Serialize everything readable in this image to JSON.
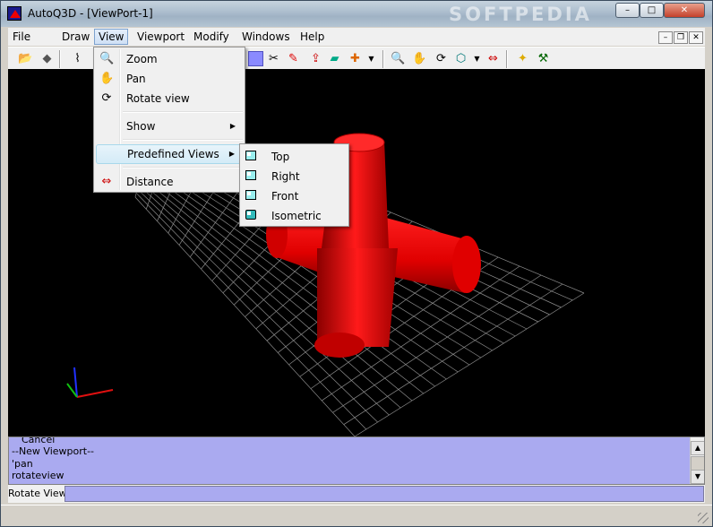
{
  "window": {
    "title": "AutoQ3D - [ViewPort-1]",
    "watermark": "SOFTPEDIA"
  },
  "caption_buttons": {
    "minimize": "–",
    "maximize": "□",
    "close": "✕"
  },
  "menubar": {
    "items": [
      "File",
      "Draw",
      "View",
      "Viewport",
      "Modify",
      "Windows",
      "Help"
    ],
    "active": "View"
  },
  "mdi_buttons": {
    "minimize": "–",
    "restore": "❐",
    "close": "✕"
  },
  "view_menu": {
    "zoom": "Zoom",
    "pan": "Pan",
    "rotate_view": "Rotate view",
    "show": "Show",
    "predefined_views": "Predefined Views",
    "distance": "Distance"
  },
  "predefined_views_submenu": {
    "top": "Top",
    "right": "Right",
    "front": "Front",
    "isometric": "Isometric"
  },
  "command_history": [
    "Cancel",
    "--New Viewport--",
    "'pan",
    "rotateview"
  ],
  "prompt": {
    "label": "Rotate View:",
    "value": ""
  },
  "colors": {
    "object": "#ff0000",
    "grid": "#9a9a9a",
    "viewport_bg": "#000000",
    "command_bg": "#aaaaf0"
  }
}
